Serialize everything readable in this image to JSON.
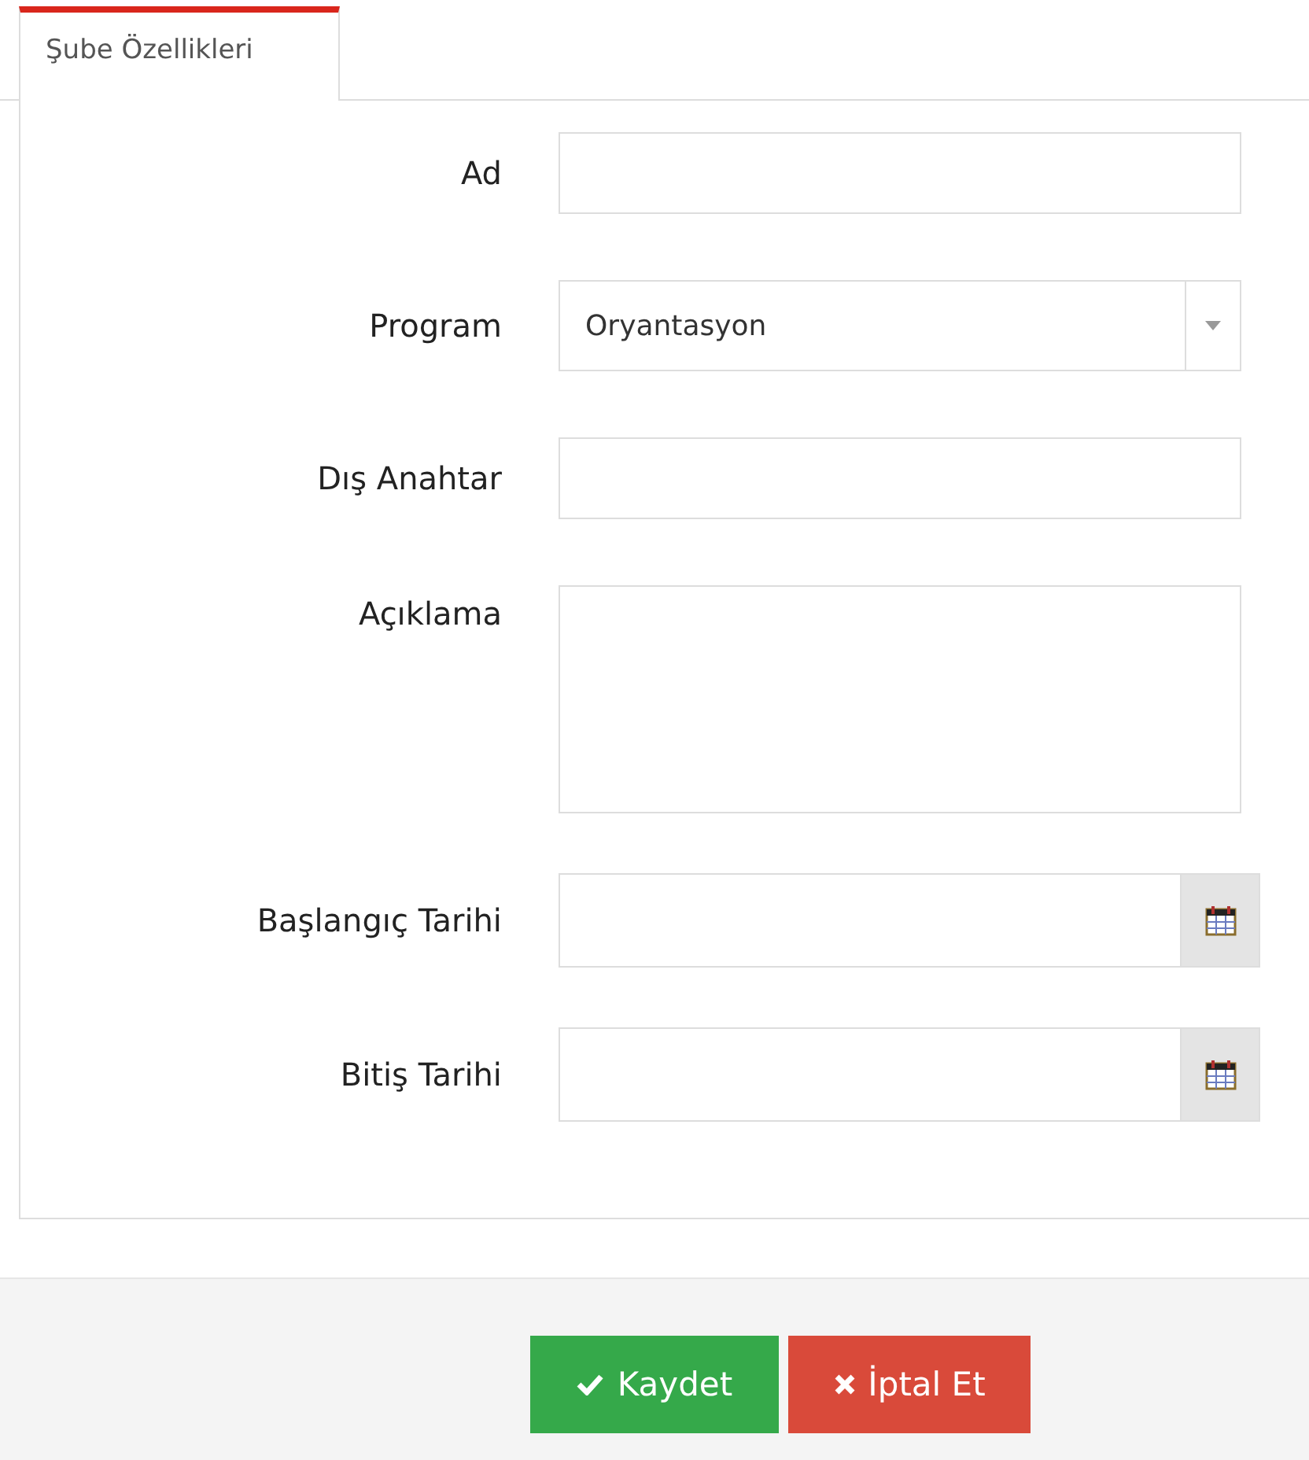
{
  "tabs": [
    {
      "label": "Şube Özellikleri",
      "selected": true
    }
  ],
  "fields": [
    {
      "kind": "text",
      "label": "Ad"
    },
    {
      "kind": "select",
      "label": "Program",
      "value": "Oryantasyon"
    },
    {
      "kind": "text",
      "label": "Dış Anahtar"
    },
    {
      "kind": "textarea",
      "label": "Açıklama"
    },
    {
      "kind": "date",
      "label": "Başlangıç Tarihi"
    },
    {
      "kind": "date",
      "label": "Bitiş Tarihi"
    }
  ],
  "buttons": [
    {
      "kind": "save",
      "label": "Kaydet"
    },
    {
      "kind": "cancel",
      "label": "İptal Et"
    }
  ]
}
